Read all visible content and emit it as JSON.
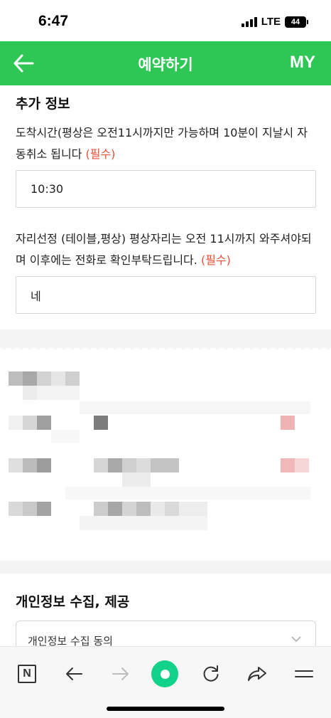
{
  "status_bar": {
    "time": "6:47",
    "network": "LTE",
    "battery": "44"
  },
  "header": {
    "back_icon": "left-arrow-icon",
    "title": "예약하기",
    "my_label": "MY",
    "color": "#2ec655"
  },
  "extra_info": {
    "title": "추가 정보",
    "arrival": {
      "label": "도착시간(평상은 오전11시까지만 가능하며 10분이 지날시 자동취소 됩니다",
      "required": "(필수)",
      "value": "10:30"
    },
    "seat": {
      "label": "자리선정 (테이블,평상) 평상자리는 오전 11시까지 와주셔야되며 이후에는 전화로 확인부탁드립니다.",
      "required": "(필수)",
      "value": "네"
    }
  },
  "privacy": {
    "title": "개인정보 수집, 제공",
    "dropdown_label": "개인정보 수집 동의"
  },
  "toolbar": {
    "items": [
      "naver-n-icon",
      "back-icon",
      "forward-icon",
      "home-icon",
      "refresh-icon",
      "share-icon",
      "menu-icon"
    ],
    "accent": "#12d188"
  }
}
